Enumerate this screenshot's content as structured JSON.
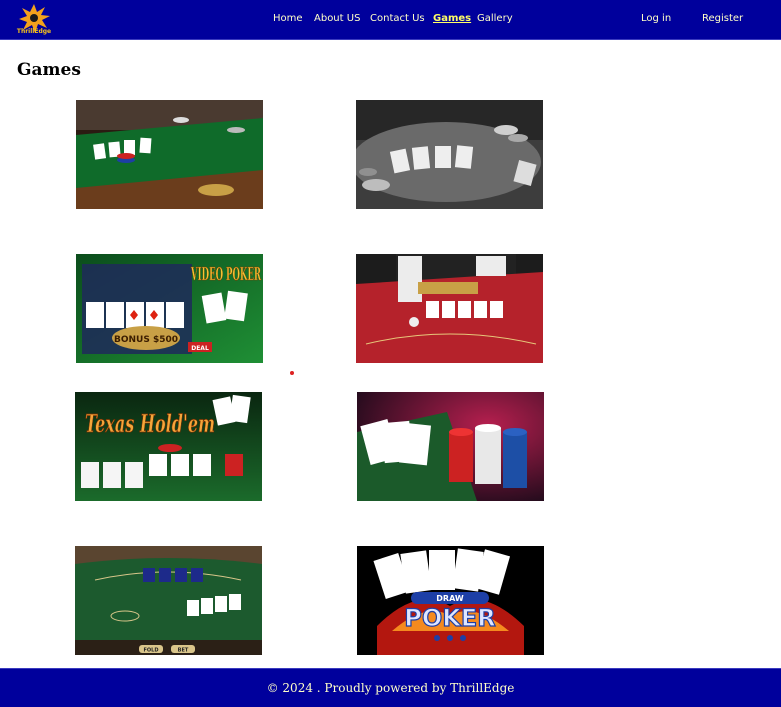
{
  "header": {
    "logo_text": "ThrillEdge",
    "nav": [
      "Home",
      "About US",
      "Contact Us",
      "Games",
      "Gallery"
    ],
    "active": "Games",
    "login_label": "Log in",
    "register_label": "Register"
  },
  "main": {
    "title": "Games",
    "games": [
      {
        "name": "poker-table-green",
        "text": ""
      },
      {
        "name": "poker-table-bw",
        "text": ""
      },
      {
        "name": "video-poker",
        "text": "VIDEO POKER",
        "badge": "BONUS $500",
        "deal": "DEAL"
      },
      {
        "name": "casino-dealer-table",
        "text": ""
      },
      {
        "name": "texas-holdem",
        "text": "Texas Hold'em"
      },
      {
        "name": "cards-and-chips",
        "text": ""
      },
      {
        "name": "blackjack-table",
        "text": "",
        "fold": "FOLD",
        "bet": "BET"
      },
      {
        "name": "draw-poker",
        "text": "POKER",
        "subtext": "DRAW"
      }
    ]
  },
  "footer": {
    "copyright": "© 2024 . Proudly powered by ThrillEdge"
  }
}
